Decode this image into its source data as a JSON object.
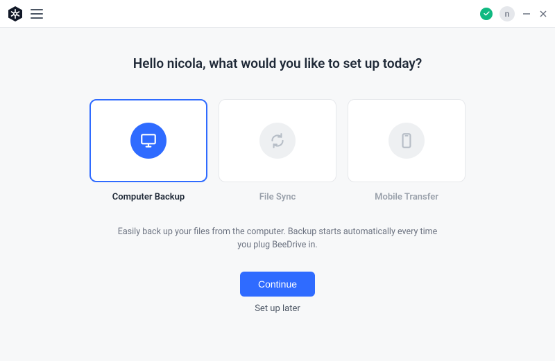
{
  "user": {
    "initial": "n"
  },
  "headline": "Hello nicola, what would you like to set up today?",
  "options": [
    {
      "id": "computer-backup",
      "label": "Computer Backup",
      "icon": "monitor",
      "selected": true
    },
    {
      "id": "file-sync",
      "label": "File Sync",
      "icon": "sync",
      "selected": false
    },
    {
      "id": "mobile-transfer",
      "label": "Mobile Transfer",
      "icon": "phone",
      "selected": false
    }
  ],
  "description": "Easily back up your files from the computer. Backup starts automatically every time you plug BeeDrive in.",
  "actions": {
    "primary": "Continue",
    "secondary": "Set up later"
  }
}
